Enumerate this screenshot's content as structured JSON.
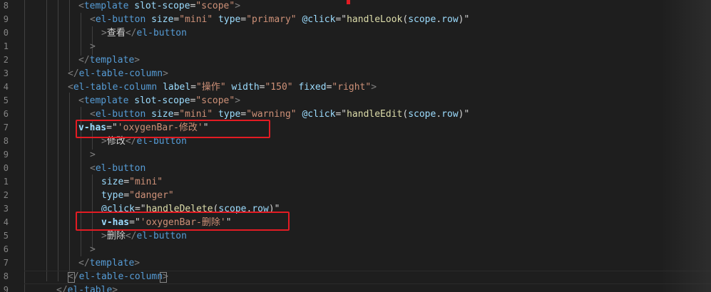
{
  "editor": {
    "colors": {
      "background": "#1e1e1e",
      "tag": "#569cd6",
      "attribute": "#9cdcfe",
      "string": "#ce9178",
      "function": "#dcdcaa",
      "text": "#d4d4d4",
      "bracket": "#808080",
      "line_number": "#858585",
      "highlight_box": "#e31b23"
    },
    "line_numbers": [
      "8",
      "9",
      "0",
      "1",
      "2",
      "3",
      "4",
      "5",
      "6",
      "7",
      "8",
      "9",
      "0",
      "1",
      "2",
      "3",
      "4",
      "5",
      "6",
      "7",
      "8",
      "9"
    ],
    "lines": [
      {
        "segments": [
          {
            "t": "<",
            "c": "bracket"
          },
          {
            "t": "template",
            "c": "tag"
          },
          {
            "t": " ",
            "c": "text"
          },
          {
            "t": "slot-scope",
            "c": "attribute"
          },
          {
            "t": "=",
            "c": "text"
          },
          {
            "t": "\"scope\"",
            "c": "string"
          },
          {
            "t": ">",
            "c": "bracket"
          }
        ]
      },
      {
        "segments": [
          {
            "t": "<",
            "c": "bracket"
          },
          {
            "t": "el-button",
            "c": "tag"
          },
          {
            "t": " ",
            "c": "text"
          },
          {
            "t": "size",
            "c": "attribute"
          },
          {
            "t": "=",
            "c": "text"
          },
          {
            "t": "\"mini\"",
            "c": "string"
          },
          {
            "t": " ",
            "c": "text"
          },
          {
            "t": "type",
            "c": "attribute"
          },
          {
            "t": "=",
            "c": "text"
          },
          {
            "t": "\"primary\"",
            "c": "string"
          },
          {
            "t": " ",
            "c": "text"
          },
          {
            "t": "@click",
            "c": "attribute"
          },
          {
            "t": "=",
            "c": "text"
          },
          {
            "t": "\"",
            "c": "text"
          },
          {
            "t": "handleLook",
            "c": "function"
          },
          {
            "t": "(",
            "c": "text"
          },
          {
            "t": "scope",
            "c": "attribute"
          },
          {
            "t": ".",
            "c": "text"
          },
          {
            "t": "row",
            "c": "attribute"
          },
          {
            "t": ")",
            "c": "text"
          },
          {
            "t": "\"",
            "c": "text"
          }
        ]
      },
      {
        "segments": [
          {
            "t": ">",
            "c": "bracket"
          },
          {
            "t": "查看",
            "c": "text"
          },
          {
            "t": "</",
            "c": "bracket"
          },
          {
            "t": "el-button",
            "c": "tag"
          }
        ]
      },
      {
        "segments": [
          {
            "t": ">",
            "c": "bracket"
          }
        ]
      },
      {
        "segments": [
          {
            "t": "</",
            "c": "bracket"
          },
          {
            "t": "template",
            "c": "tag"
          },
          {
            "t": ">",
            "c": "bracket"
          }
        ]
      },
      {
        "segments": [
          {
            "t": "</",
            "c": "bracket"
          },
          {
            "t": "el-table-column",
            "c": "tag"
          },
          {
            "t": ">",
            "c": "bracket"
          }
        ]
      },
      {
        "segments": [
          {
            "t": "<",
            "c": "bracket"
          },
          {
            "t": "el-table-column",
            "c": "tag"
          },
          {
            "t": " ",
            "c": "text"
          },
          {
            "t": "label",
            "c": "attribute"
          },
          {
            "t": "=",
            "c": "text"
          },
          {
            "t": "\"操作\"",
            "c": "string"
          },
          {
            "t": " ",
            "c": "text"
          },
          {
            "t": "width",
            "c": "attribute"
          },
          {
            "t": "=",
            "c": "text"
          },
          {
            "t": "\"150\"",
            "c": "string"
          },
          {
            "t": " ",
            "c": "text"
          },
          {
            "t": "fixed",
            "c": "attribute"
          },
          {
            "t": "=",
            "c": "text"
          },
          {
            "t": "\"right\"",
            "c": "string"
          },
          {
            "t": ">",
            "c": "bracket"
          }
        ]
      },
      {
        "segments": [
          {
            "t": "<",
            "c": "bracket"
          },
          {
            "t": "template",
            "c": "tag"
          },
          {
            "t": " ",
            "c": "text"
          },
          {
            "t": "slot-scope",
            "c": "attribute"
          },
          {
            "t": "=",
            "c": "text"
          },
          {
            "t": "\"scope\"",
            "c": "string"
          },
          {
            "t": ">",
            "c": "bracket"
          }
        ]
      },
      {
        "segments": [
          {
            "t": "<",
            "c": "bracket"
          },
          {
            "t": "el-button",
            "c": "tag"
          },
          {
            "t": " ",
            "c": "text"
          },
          {
            "t": "size",
            "c": "attribute"
          },
          {
            "t": "=",
            "c": "text"
          },
          {
            "t": "\"mini\"",
            "c": "string"
          },
          {
            "t": " ",
            "c": "text"
          },
          {
            "t": "type",
            "c": "attribute"
          },
          {
            "t": "=",
            "c": "text"
          },
          {
            "t": "\"warning\"",
            "c": "string"
          },
          {
            "t": " ",
            "c": "text"
          },
          {
            "t": "@click",
            "c": "attribute"
          },
          {
            "t": "=",
            "c": "text"
          },
          {
            "t": "\"",
            "c": "text"
          },
          {
            "t": "handleEdit",
            "c": "function"
          },
          {
            "t": "(",
            "c": "text"
          },
          {
            "t": "scope",
            "c": "attribute"
          },
          {
            "t": ".",
            "c": "text"
          },
          {
            "t": "row",
            "c": "attribute"
          },
          {
            "t": ")",
            "c": "text"
          },
          {
            "t": "\"",
            "c": "text"
          }
        ]
      },
      {
        "segments": [
          {
            "t": "v-has",
            "c": "attribute"
          },
          {
            "t": "=",
            "c": "text"
          },
          {
            "t": "\"",
            "c": "text"
          },
          {
            "t": "'oxygenBar-修改'",
            "c": "string"
          },
          {
            "t": "\"",
            "c": "text"
          }
        ]
      },
      {
        "segments": [
          {
            "t": ">",
            "c": "bracket"
          },
          {
            "t": "修改",
            "c": "text"
          },
          {
            "t": "</",
            "c": "bracket"
          },
          {
            "t": "el-button",
            "c": "tag"
          }
        ]
      },
      {
        "segments": [
          {
            "t": ">",
            "c": "bracket"
          }
        ]
      },
      {
        "segments": [
          {
            "t": "<",
            "c": "bracket"
          },
          {
            "t": "el-button",
            "c": "tag"
          }
        ]
      },
      {
        "segments": [
          {
            "t": "size",
            "c": "attribute"
          },
          {
            "t": "=",
            "c": "text"
          },
          {
            "t": "\"mini\"",
            "c": "string"
          }
        ]
      },
      {
        "segments": [
          {
            "t": "type",
            "c": "attribute"
          },
          {
            "t": "=",
            "c": "text"
          },
          {
            "t": "\"danger\"",
            "c": "string"
          }
        ]
      },
      {
        "segments": [
          {
            "t": "@click",
            "c": "attribute"
          },
          {
            "t": "=",
            "c": "text"
          },
          {
            "t": "\"",
            "c": "text"
          },
          {
            "t": "handleDelete",
            "c": "function"
          },
          {
            "t": "(",
            "c": "text"
          },
          {
            "t": "scope",
            "c": "attribute"
          },
          {
            "t": ".",
            "c": "text"
          },
          {
            "t": "row",
            "c": "attribute"
          },
          {
            "t": ")",
            "c": "text"
          },
          {
            "t": "\"",
            "c": "text"
          }
        ]
      },
      {
        "segments": [
          {
            "t": "v-has",
            "c": "attribute"
          },
          {
            "t": "=",
            "c": "text"
          },
          {
            "t": "\"",
            "c": "text"
          },
          {
            "t": "'oxygenBar-删除'",
            "c": "string"
          },
          {
            "t": "\"",
            "c": "text"
          }
        ]
      },
      {
        "segments": [
          {
            "t": ">",
            "c": "bracket"
          },
          {
            "t": "删除",
            "c": "text"
          },
          {
            "t": "</",
            "c": "bracket"
          },
          {
            "t": "el-button",
            "c": "tag"
          }
        ]
      },
      {
        "segments": [
          {
            "t": ">",
            "c": "bracket"
          }
        ]
      },
      {
        "segments": [
          {
            "t": "</",
            "c": "bracket"
          },
          {
            "t": "template",
            "c": "tag"
          },
          {
            "t": ">",
            "c": "bracket"
          }
        ]
      },
      {
        "segments": [
          {
            "t": "</",
            "c": "bracket"
          },
          {
            "t": "el-table-column",
            "c": "tag"
          },
          {
            "t": ">",
            "c": "bracket"
          }
        ]
      },
      {
        "segments": [
          {
            "t": "</",
            "c": "bracket"
          },
          {
            "t": "el-table",
            "c": "tag"
          },
          {
            "t": ">",
            "c": "bracket"
          }
        ]
      }
    ]
  }
}
